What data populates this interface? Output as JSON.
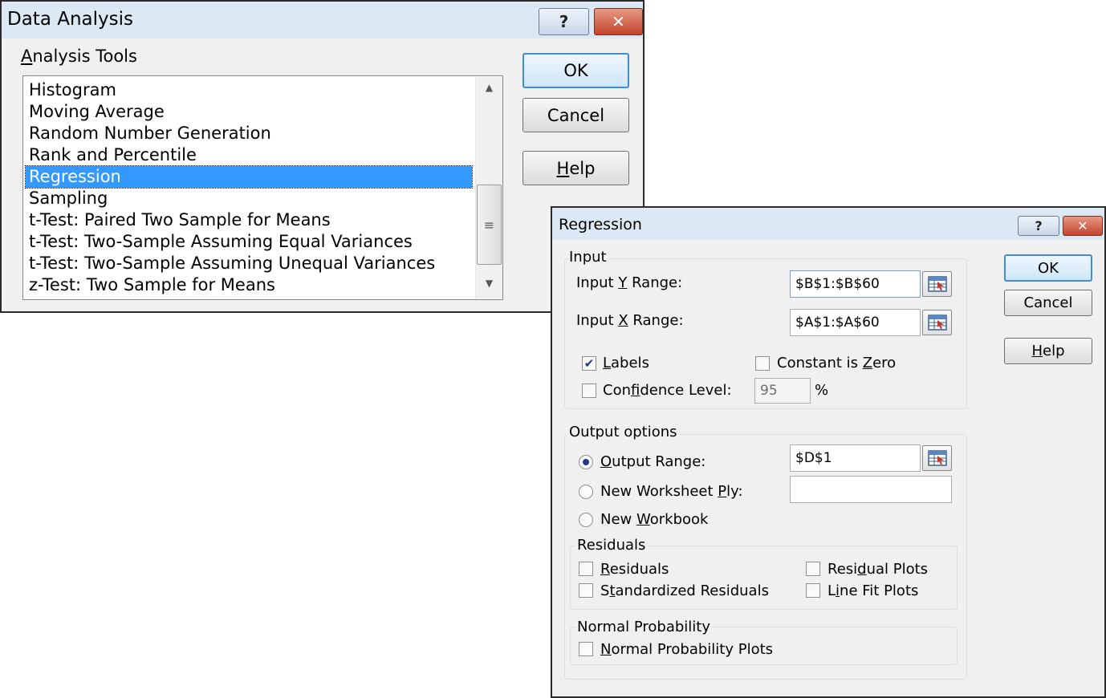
{
  "data_analysis": {
    "title": "Data Analysis",
    "help_glyph": "?",
    "close_glyph": "✕",
    "tools_label_underlined": "A",
    "tools_label_rest": "nalysis Tools",
    "tools": [
      "Histogram",
      "Moving Average",
      "Random Number Generation",
      "Rank and Percentile",
      "Regression",
      "Sampling",
      "t-Test: Paired Two Sample for Means",
      "t-Test: Two-Sample Assuming Equal Variances",
      "t-Test: Two-Sample Assuming Unequal Variances",
      "z-Test: Two Sample for Means"
    ],
    "selected_tool": "Regression",
    "ok_label": "OK",
    "cancel_label": "Cancel",
    "help_underlined": "H",
    "help_rest": "elp"
  },
  "regression": {
    "title": "Regression",
    "help_glyph": "?",
    "close_glyph": "✕",
    "input_group": "Input",
    "input_y": {
      "pre": "Input ",
      "u": "Y",
      "post": " Range:",
      "value": "$B$1:$B$60"
    },
    "input_x": {
      "pre": "Input ",
      "u": "X",
      "post": " Range:",
      "value": "$A$1:$A$60"
    },
    "labels": {
      "pre": "",
      "u": "L",
      "post": "abels",
      "checked": true
    },
    "constant_zero": {
      "pre": "Constant is ",
      "u": "Z",
      "post": "ero",
      "checked": false
    },
    "confidence": {
      "pre": "Con",
      "u": "f",
      "post": "idence Level:",
      "checked": false,
      "value": "95",
      "unit": "%"
    },
    "output_group": "Output options",
    "output_range": {
      "pre": "",
      "u": "O",
      "post": "utput Range:",
      "selected": true,
      "value": "$D$1"
    },
    "new_worksheet": {
      "pre": "New Worksheet ",
      "u": "P",
      "post": "ly:",
      "selected": false,
      "value": ""
    },
    "new_workbook": {
      "pre": "New ",
      "u": "W",
      "post": "orkbook",
      "selected": false
    },
    "residuals_group": "Residuals",
    "residuals": {
      "pre": "",
      "u": "R",
      "post": "esiduals",
      "checked": false
    },
    "standardized": {
      "pre": "S",
      "u": "t",
      "post": "andardized Residuals",
      "checked": false
    },
    "residual_plots": {
      "pre": "Resi",
      "u": "d",
      "post": "ual Plots",
      "checked": false
    },
    "line_fit": {
      "pre": "L",
      "u": "i",
      "post": "ne Fit Plots",
      "checked": false
    },
    "normal_group": "Normal Probability",
    "normal_plots": {
      "pre": "",
      "u": "N",
      "post": "ormal Probability Plots",
      "checked": false
    },
    "ok_label": "OK",
    "cancel_label": "Cancel",
    "help_underlined": "H",
    "help_rest": "elp"
  },
  "colors": {
    "selection": "#3399ff",
    "titlebar": "#dde8f5",
    "dialog_bg": "#f0f0f0",
    "close_button": "#c4432b"
  }
}
